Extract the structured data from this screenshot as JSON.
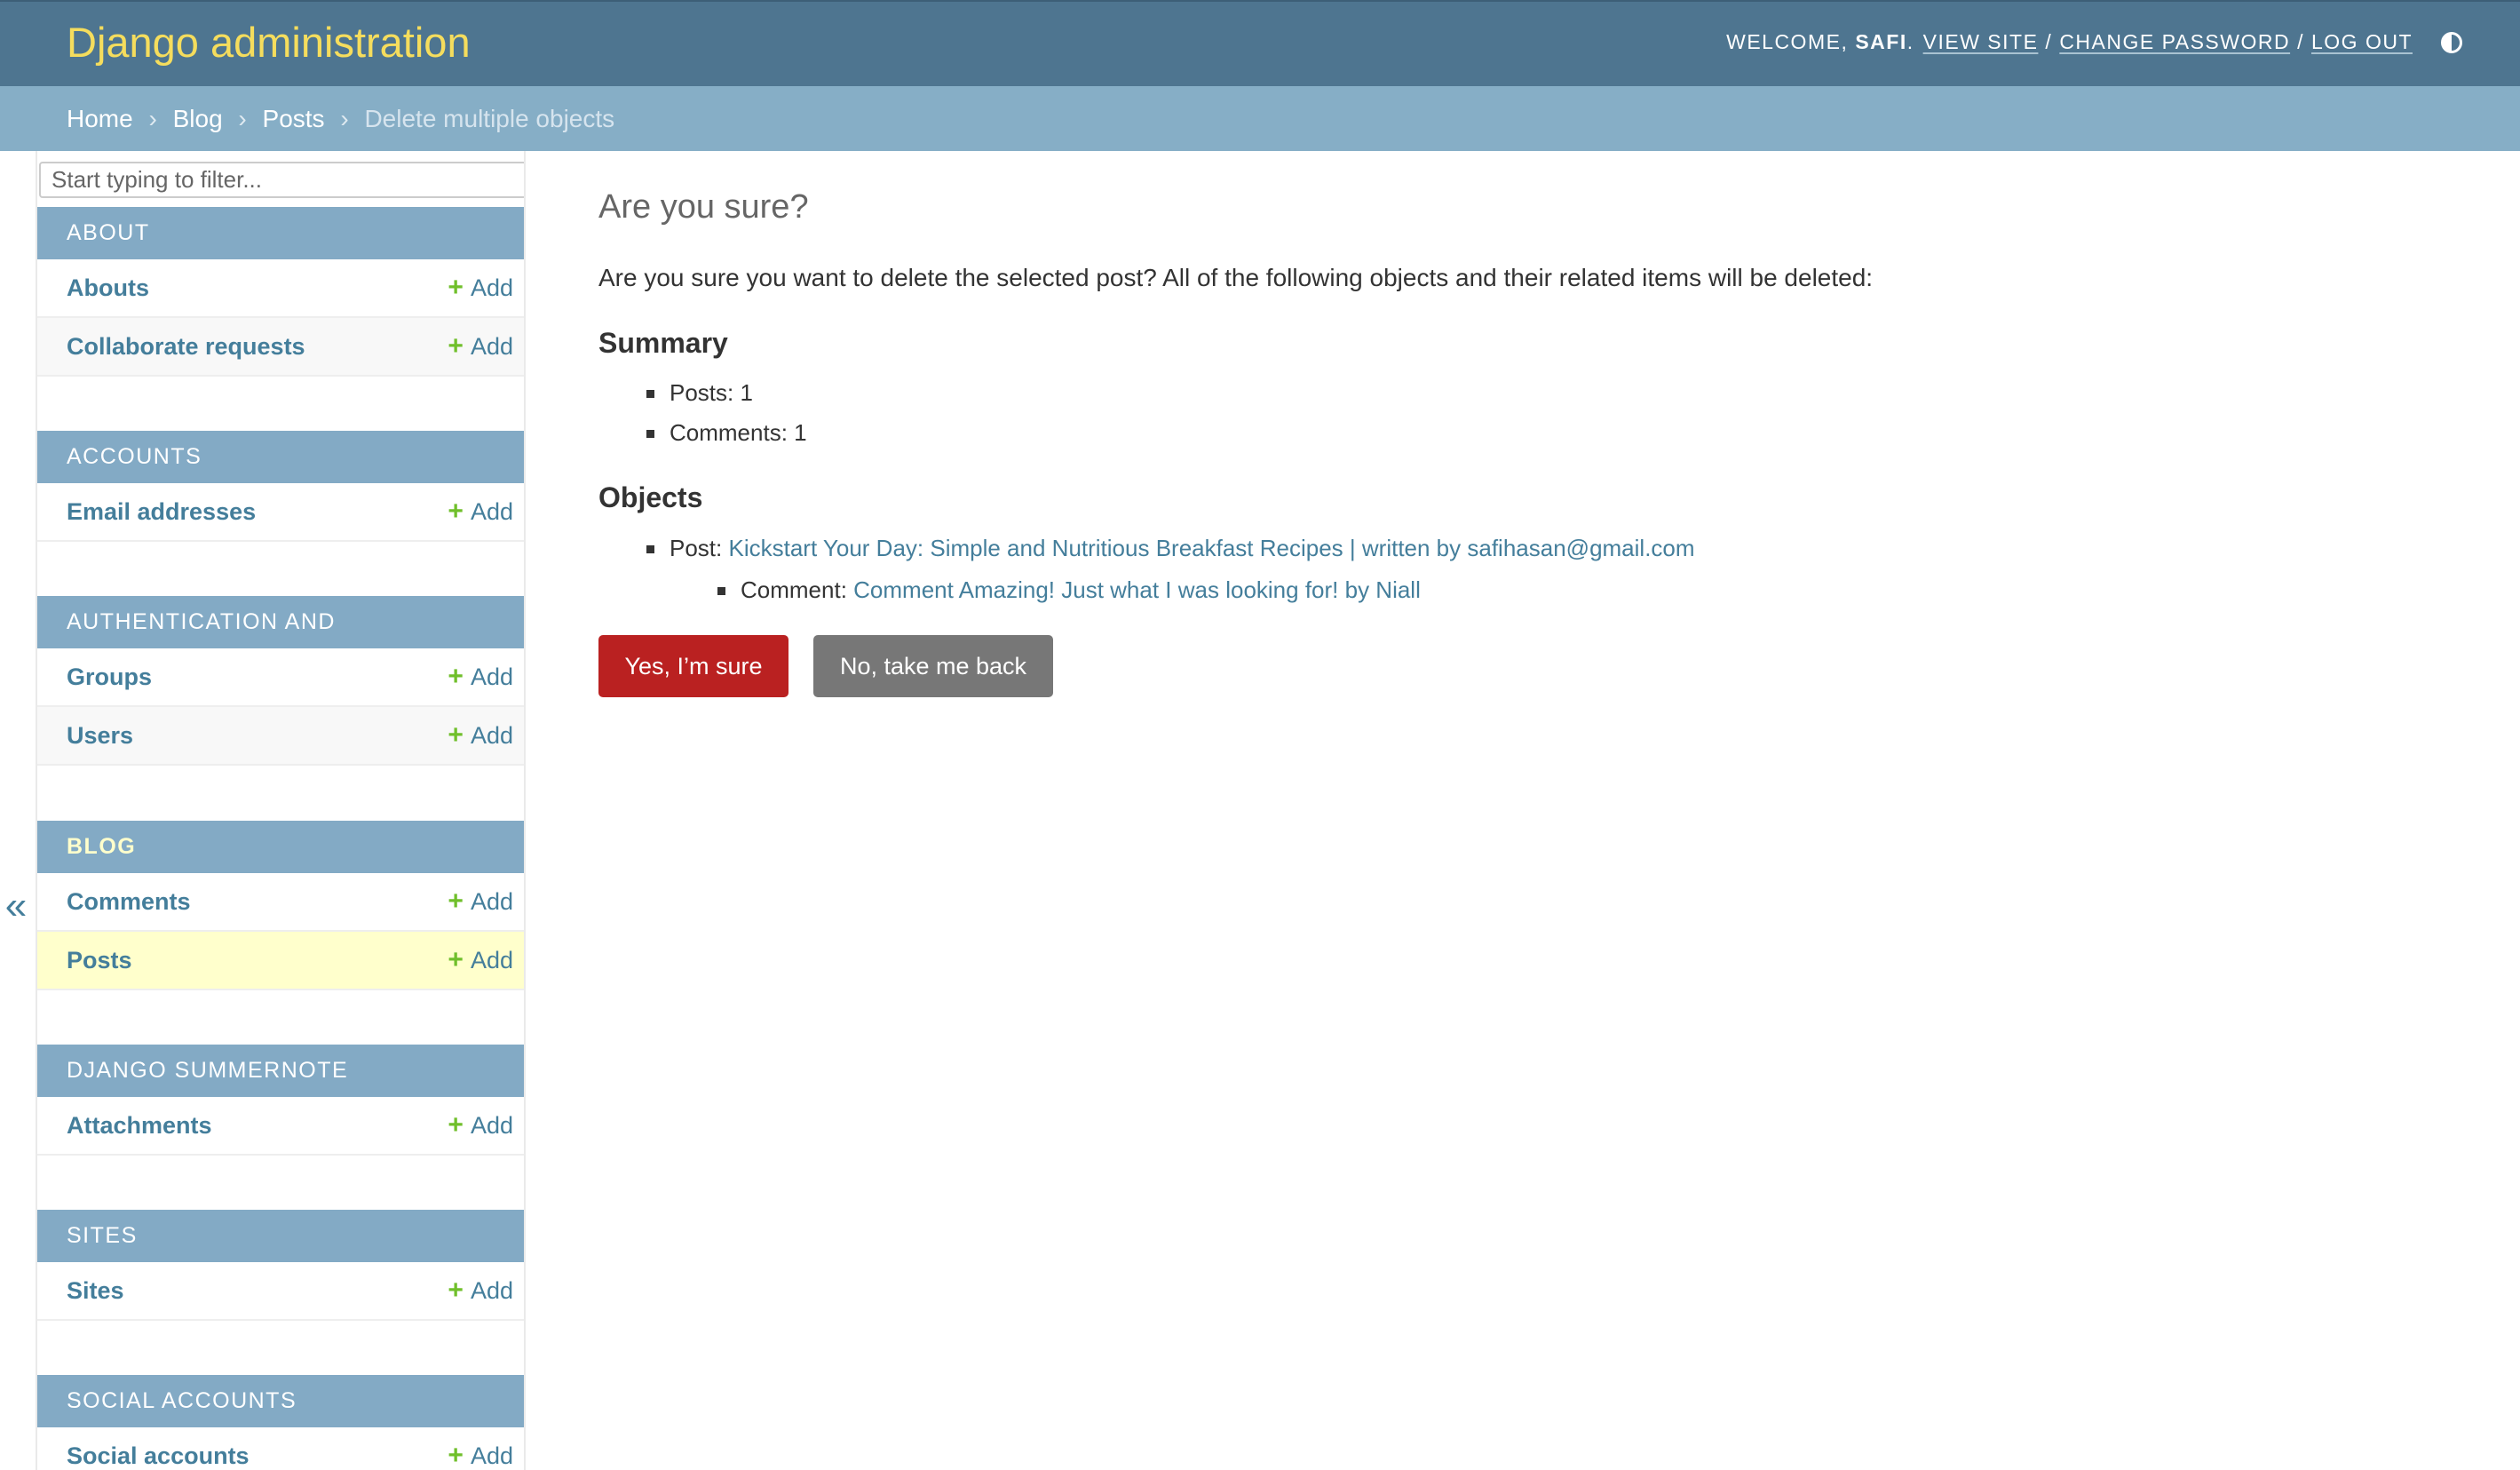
{
  "header": {
    "site_name": "Django administration",
    "welcome": "WELCOME,",
    "username": "SAFI",
    "username_suffix": ".",
    "view_site": "VIEW SITE",
    "change_password": "CHANGE PASSWORD",
    "log_out": "LOG OUT",
    "separator": "/",
    "theme_icon": "contrast-icon"
  },
  "breadcrumbs": {
    "items": [
      "Home",
      "Blog",
      "Posts"
    ],
    "separator": "›",
    "current": "Delete multiple objects"
  },
  "sidebar": {
    "filter_placeholder": "Start typing to filter...",
    "collapse_label": "«",
    "add_label": "Add",
    "add_icon": "+",
    "modules": [
      {
        "caption": "ABOUT",
        "models": [
          "Abouts",
          "Collaborate requests"
        ]
      },
      {
        "caption": "ACCOUNTS",
        "models": [
          "Email addresses"
        ]
      },
      {
        "caption": "AUTHENTICATION AND AUTHORIZATION",
        "models": [
          "Groups",
          "Users"
        ]
      },
      {
        "caption": "BLOG",
        "models": [
          "Comments",
          "Posts"
        ]
      },
      {
        "caption": "DJANGO SUMMERNOTE",
        "models": [
          "Attachments"
        ]
      },
      {
        "caption": "SITES",
        "models": [
          "Sites"
        ]
      },
      {
        "caption": "SOCIAL ACCOUNTS",
        "models": [
          "Social accounts"
        ]
      }
    ]
  },
  "content": {
    "title": "Are you sure?",
    "intro": "Are you sure you want to delete the selected post? All of the following objects and their related items will be deleted:",
    "summary_heading": "Summary",
    "summary_items": [
      "Posts: 1",
      "Comments: 1"
    ],
    "objects_heading": "Objects",
    "post_label": "Post:",
    "post_link": "Kickstart Your Day: Simple and Nutritious Breakfast Recipes | written by safihasan@gmail.com",
    "comment_label": "Comment:",
    "comment_link": "Comment Amazing! Just what I was looking for! by Niall",
    "confirm_button": "Yes, I’m sure",
    "cancel_button": "No, take me back"
  },
  "colors": {
    "header_bg": "#4e7590",
    "branding": "#f5dd5d",
    "breadcrumbs_bg": "#86aec6",
    "module_caption_bg": "#83aac5",
    "link": "#447e9b",
    "add_plus": "#70bf2b",
    "current_row_bg": "#ffffcc",
    "danger": "#ba2121",
    "cancel": "#777777"
  }
}
